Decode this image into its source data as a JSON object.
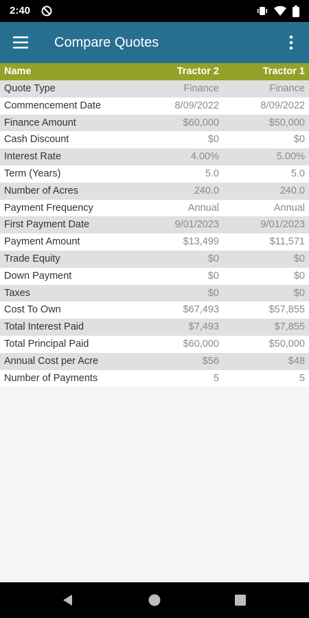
{
  "status_bar": {
    "time": "2:40",
    "icons": [
      "do-not-disturb-icon",
      "vibrate-icon",
      "wifi-icon",
      "battery-icon"
    ]
  },
  "app_bar": {
    "title": "Compare Quotes",
    "icons": [
      "menu-icon",
      "overflow-menu-icon"
    ]
  },
  "table": {
    "headers": {
      "name": "Name",
      "col1": "Tractor 2",
      "col2": "Tractor 1"
    },
    "rows": [
      {
        "name": "Quote Type",
        "v1": "Finance",
        "v2": "Finance"
      },
      {
        "name": "Commencement Date",
        "v1": "8/09/2022",
        "v2": "8/09/2022"
      },
      {
        "name": "Finance Amount",
        "v1": "$60,000",
        "v2": "$50,000"
      },
      {
        "name": "Cash Discount",
        "v1": "$0",
        "v2": "$0"
      },
      {
        "name": "Interest Rate",
        "v1": "4.00%",
        "v2": "5.00%"
      },
      {
        "name": "Term (Years)",
        "v1": "5.0",
        "v2": "5.0"
      },
      {
        "name": "Number of Acres",
        "v1": "240.0",
        "v2": "240.0"
      },
      {
        "name": "Payment Frequency",
        "v1": "Annual",
        "v2": "Annual"
      },
      {
        "name": "First Payment Date",
        "v1": "9/01/2023",
        "v2": "9/01/2023"
      },
      {
        "name": "Payment Amount",
        "v1": "$13,499",
        "v2": "$11,571"
      },
      {
        "name": "Trade Equity",
        "v1": "$0",
        "v2": "$0"
      },
      {
        "name": "Down Payment",
        "v1": "$0",
        "v2": "$0"
      },
      {
        "name": "Taxes",
        "v1": "$0",
        "v2": "$0"
      },
      {
        "name": "Cost To Own",
        "v1": "$67,493",
        "v2": "$57,855"
      },
      {
        "name": "Total Interest Paid",
        "v1": "$7,493",
        "v2": "$7,855"
      },
      {
        "name": "Total Principal Paid",
        "v1": "$60,000",
        "v2": "$50,000"
      },
      {
        "name": "Annual Cost per Acre",
        "v1": "$56",
        "v2": "$48"
      },
      {
        "name": "Number of Payments",
        "v1": "5",
        "v2": "5"
      }
    ]
  },
  "nav_bar": {
    "icons": [
      "back-icon",
      "home-icon",
      "recents-icon"
    ]
  },
  "colors": {
    "status_bar": "#000000",
    "app_bar": "#266f91",
    "table_header": "#93a228",
    "row_alt": "#e0e0e0",
    "row_white": "#ffffff",
    "background": "#f5f5f5"
  }
}
